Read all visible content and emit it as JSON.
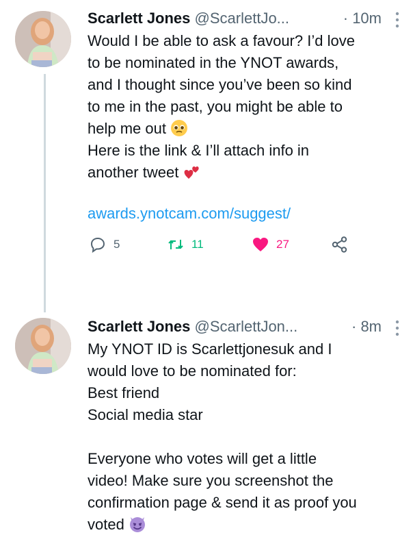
{
  "tweets": [
    {
      "author_name": "Scarlett Jones",
      "handle": "@ScarlettJo...",
      "time": "· 10m",
      "paragraph1": "Would I be able to ask a favour? I’d love\nto be nominated in the YNOT awards,\nand I thought since you’ve been so kind\nto me in the past, you might be able to\nhelp me out ",
      "emoji1": "smiling-face-with-pleading-eyes-emoji",
      "paragraph2": "Here is the link & I’ll attach info in\nanother tweet ",
      "emoji2": "two-hearts-emoji",
      "link": "awards.ynotcam.com/suggest/",
      "actions": {
        "replies": "5",
        "retweets": "11",
        "likes": "27"
      },
      "colors": {
        "retweet": "#00ba7c",
        "like": "#f91880",
        "link": "#1d9bf0"
      }
    },
    {
      "author_name": "Scarlett Jones",
      "handle": "@ScarlettJon...",
      "time": "· 8m",
      "paragraph1": "My YNOT ID is Scarlettjonesuk and I\nwould love to be nominated for:\nBest friend\nSocial media star",
      "paragraph2": "Everyone who votes will get a little\nvideo! Make sure you screenshot the\nconfirmation page & send it as proof you\nvoted ",
      "emoji2": "smiling-face-with-horns-emoji"
    }
  ]
}
